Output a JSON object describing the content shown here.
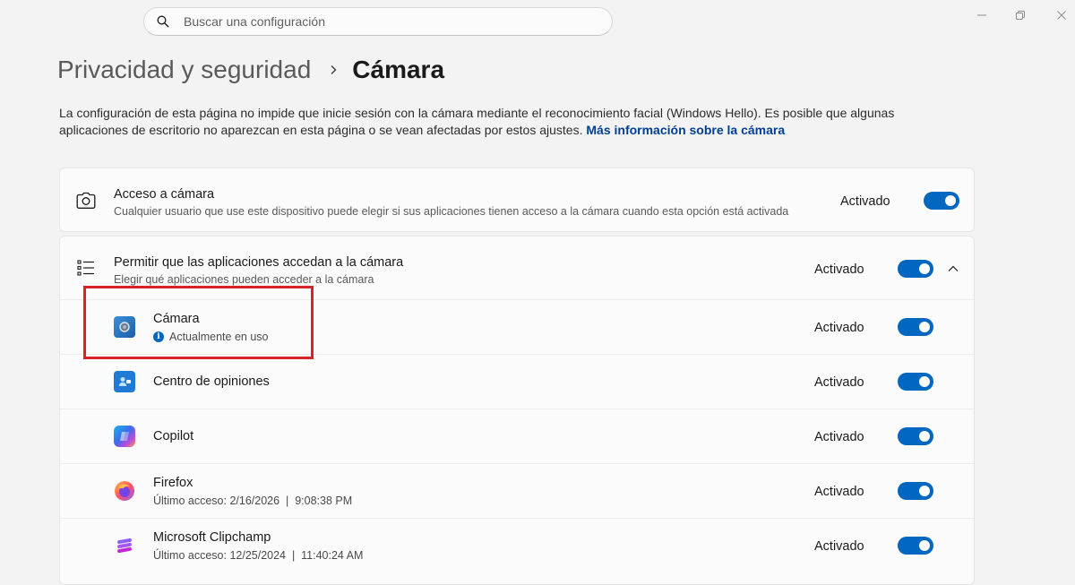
{
  "search": {
    "placeholder": "Buscar una configuración"
  },
  "breadcrumb": {
    "parent": "Privacidad y seguridad",
    "current": "Cámara"
  },
  "description": {
    "text": "La configuración de esta página no impide que inicie sesión con la cámara mediante el reconocimiento facial (Windows Hello). Es posible que algunas aplicaciones de escritorio no aparezcan en esta página o se vean afectadas por estos ajustes.",
    "link": "Más información sobre la cámara"
  },
  "camera_access": {
    "title": "Acceso a cámara",
    "subtitle": "Cualquier usuario que use este dispositivo puede elegir si sus aplicaciones tienen acceso a la cámara cuando esta opción está activada",
    "state": "Activado"
  },
  "apps_access": {
    "title": "Permitir que las aplicaciones accedan a la cámara",
    "subtitle": "Elegir qué aplicaciones pueden acceder a la cámara",
    "state": "Activado"
  },
  "apps": [
    {
      "name": "Cámara",
      "sub": "Actualmente en uso",
      "state": "Activado",
      "icon": "camera-app-icon"
    },
    {
      "name": "Centro de opiniones",
      "sub": "",
      "state": "Activado",
      "icon": "feedback-hub-icon"
    },
    {
      "name": "Copilot",
      "sub": "",
      "state": "Activado",
      "icon": "copilot-icon"
    },
    {
      "name": "Firefox",
      "sub": "Último acceso: 2/16/2026  |  9:08:38 PM",
      "state": "Activado",
      "icon": "firefox-icon"
    },
    {
      "name": "Microsoft Clipchamp",
      "sub": "Último acceso: 12/25/2024  |  11:40:24 AM",
      "state": "Activado",
      "icon": "clipchamp-icon"
    }
  ],
  "colors": {
    "accent": "#0067c0",
    "highlight": "#d8232a"
  }
}
